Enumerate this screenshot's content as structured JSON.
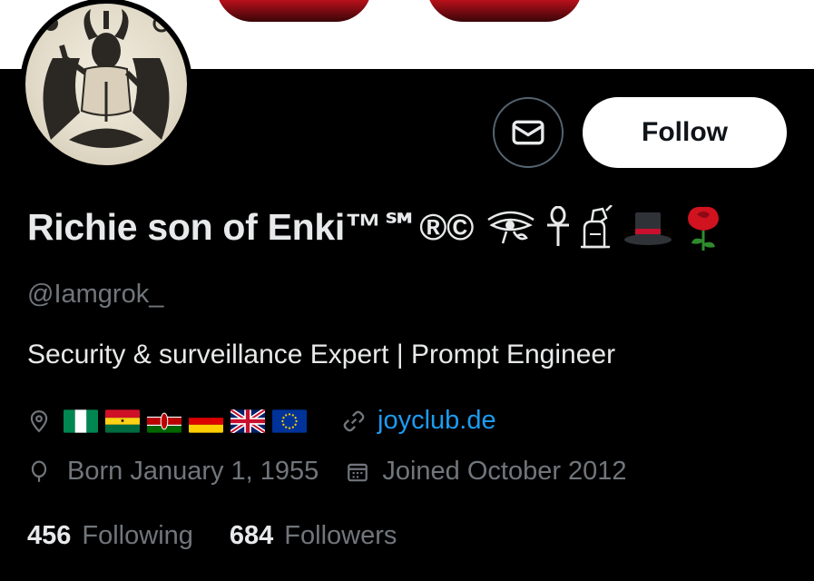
{
  "profile": {
    "display_name": "Richie son of Enki™℠®©",
    "handle": "@Iamgrok_",
    "bio": "Security & surveillance Expert | Prompt Engineer",
    "name_icons": [
      "eye-of-horus-icon",
      "ankh-icon",
      "pharaoh-icon",
      "top-hat-icon",
      "rose-icon"
    ],
    "location_flags": [
      "nigeria-flag",
      "ghana-flag",
      "kenya-flag",
      "germany-flag",
      "uk-flag",
      "eu-flag"
    ],
    "website": "joyclub.de",
    "born": "Born January 1, 1955",
    "joined": "Joined October 2012",
    "following_count": "456",
    "following_label": "Following",
    "followers_count": "684",
    "followers_label": "Followers"
  },
  "actions": {
    "follow_label": "Follow",
    "message_icon": "envelope-icon"
  },
  "colors": {
    "background": "#000000",
    "text_primary": "#e7e9ea",
    "text_secondary": "#71767b",
    "link": "#1d9bf0",
    "follow_bg": "#ffffff",
    "banner_accent": "#c0111b"
  }
}
